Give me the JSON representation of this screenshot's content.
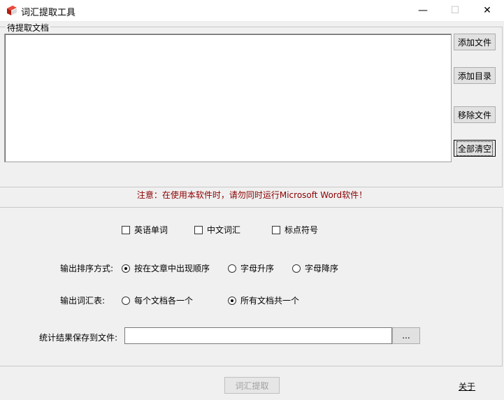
{
  "window": {
    "title": "词汇提取工具",
    "minimize": "—",
    "maximize": "☐",
    "close": "✕"
  },
  "files_group": {
    "label": "待提取文档",
    "add_file": "添加文件",
    "add_dir": "添加目录",
    "remove_file": "移除文件",
    "clear_all": "全部清空"
  },
  "notice": "注意：在使用本软件时，请勿同时运行Microsoft Word软件！",
  "options": {
    "word_types": [
      {
        "label": "英语单词",
        "checked": false
      },
      {
        "label": "中文词汇",
        "checked": false
      },
      {
        "label": "标点符号",
        "checked": false
      }
    ],
    "sort_label": "输出排序方式:",
    "sort_options": [
      {
        "label": "按在文章中出现顺序",
        "selected": true
      },
      {
        "label": "字母升序",
        "selected": false
      },
      {
        "label": "字母降序",
        "selected": false
      }
    ],
    "output_label": "输出词汇表:",
    "output_options": [
      {
        "label": "每个文档各一个",
        "selected": false
      },
      {
        "label": "所有文档共一个",
        "selected": true
      }
    ],
    "save_label": "统计结果保存到文件:",
    "save_value": "",
    "browse": "..."
  },
  "footer": {
    "extract": "词汇提取",
    "about": "关于"
  }
}
